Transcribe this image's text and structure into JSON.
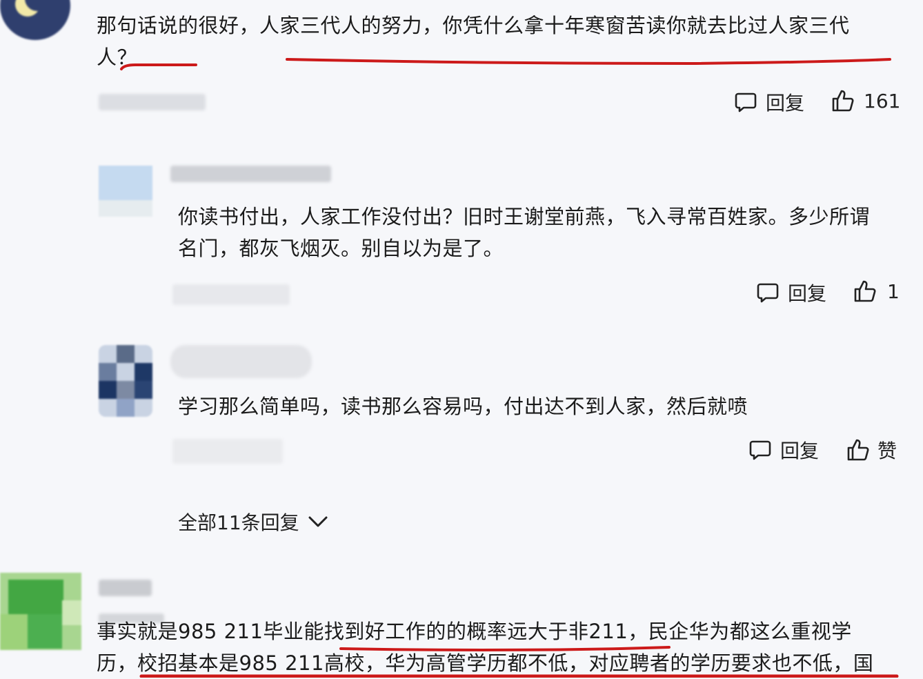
{
  "comment1": {
    "text_line1": "那句话说的很好，人家三代人的努力，你凭什么拿十年寒窗苦读你就去比过人家三代",
    "text_line2": "人？",
    "reply_label": "回复",
    "like_count": "161"
  },
  "reply1": {
    "text_line1": "你读书付出，人家工作没付出？旧时王谢堂前燕，飞入寻常百姓家。多少所谓",
    "text_line2": "名门，都灰飞烟灭。别自以为是了。",
    "reply_label": "回复",
    "like_count": "1"
  },
  "reply2": {
    "text": "学习那么简单吗，读书那么容易吗，付出达不到人家，然后就喷",
    "reply_label": "回复",
    "like_label": "赞"
  },
  "view_all_replies": "全部11条回复",
  "comment2": {
    "text_line1": "事实就是985 211毕业能找到好工作的的概率远大于非211，民企华为都这么重视学",
    "text_line2": "历，校招基本是985 211高校，华为高管学历都不低，对应聘者的学历要求也不低，国"
  },
  "colors": {
    "background": "#f6f7fa",
    "underline": "#cc1a1a",
    "text": "#1b1b1b"
  }
}
